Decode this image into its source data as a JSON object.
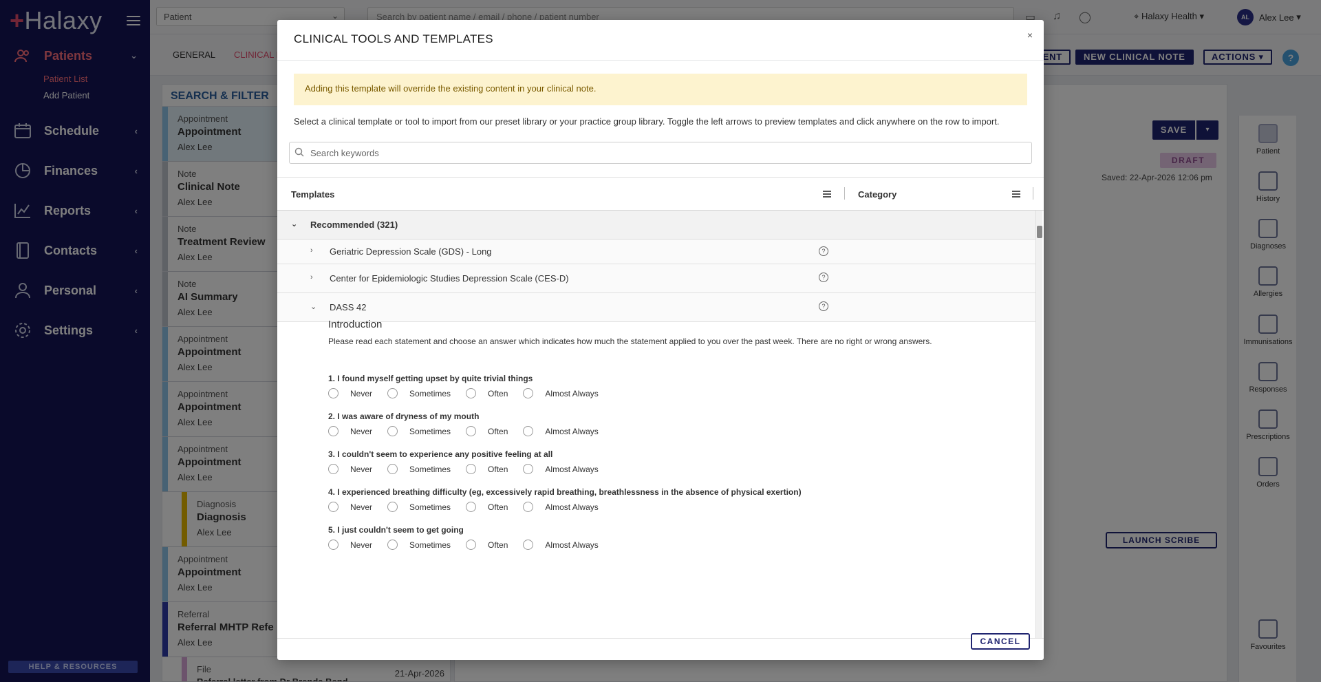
{
  "app": {
    "logo_text": "Halaxy",
    "help_resources": "HELP & RESOURCES"
  },
  "sidebar": {
    "items": [
      {
        "label": "Patients",
        "icon": "people-icon"
      },
      {
        "label": "Schedule",
        "icon": "calendar-icon"
      },
      {
        "label": "Finances",
        "icon": "pie-chart-icon"
      },
      {
        "label": "Reports",
        "icon": "line-chart-icon"
      },
      {
        "label": "Contacts",
        "icon": "contact-book-icon"
      },
      {
        "label": "Personal",
        "icon": "person-icon"
      },
      {
        "label": "Settings",
        "icon": "gear-icon"
      }
    ],
    "sub_items": [
      "Patient List",
      "Add Patient"
    ]
  },
  "topbar": {
    "patient_select": "Patient",
    "search_placeholder": "Search by patient name / email / phone / patient number",
    "organization": "Halaxy Health",
    "user_initials": "AL",
    "user_name": "Alex Lee"
  },
  "tabs": {
    "general": "GENERAL",
    "clinical": "CLINICAL N"
  },
  "header_buttons": {
    "ent": "ENT",
    "new_clinical_note": "NEW CLINICAL NOTE",
    "actions": "ACTIONS",
    "help": "?"
  },
  "filter": {
    "title": "SEARCH & FILTER",
    "cards": [
      {
        "type": "Appointment",
        "title": "Appointment",
        "who": "Alex Lee",
        "color": "#8ec5e8"
      },
      {
        "type": "Note",
        "title": "Clinical Note",
        "who": "Alex Lee",
        "color": "#bfc4cc"
      },
      {
        "type": "Note",
        "title": "Treatment Review",
        "who": "Alex Lee",
        "color": "#bfc4cc"
      },
      {
        "type": "Note",
        "title": "AI Summary",
        "who": "Alex Lee",
        "color": "#bfc4cc"
      },
      {
        "type": "Appointment",
        "title": "Appointment",
        "who": "Alex Lee",
        "color": "#8ec5e8"
      },
      {
        "type": "Appointment",
        "title": "Appointment",
        "who": "Alex Lee",
        "color": "#8ec5e8"
      },
      {
        "type": "Appointment",
        "title": "Appointment",
        "who": "Alex Lee",
        "color": "#8ec5e8"
      },
      {
        "type": "Diagnosis",
        "title": "Diagnosis",
        "who": "Alex Lee",
        "color": "#e6b800"
      },
      {
        "type": "Appointment",
        "title": "Appointment",
        "who": "Alex Lee",
        "color": "#8ec5e8"
      },
      {
        "type": "Referral",
        "title": "Referral MHTP Refe",
        "who": "Alex Lee",
        "color": "#2e3aa8"
      },
      {
        "type": "File",
        "title": "Referral letter from Dr Brenda Bend",
        "who": "21-Apr-2026",
        "color": "#d9a6d9"
      }
    ]
  },
  "editor": {
    "save": "SAVE",
    "status": "DRAFT",
    "saved_at": "Saved: 22-Apr-2026 12:06 pm",
    "launch_scribe": "LAUNCH SCRIBE"
  },
  "rail": {
    "items": [
      "Patient",
      "History",
      "Diagnoses",
      "Allergies",
      "Immunisations",
      "Responses",
      "Prescriptions",
      "Orders",
      "Favourites"
    ]
  },
  "modal": {
    "title": "CLINICAL TOOLS AND TEMPLATES",
    "warning": "Adding this template will override the existing content in your clinical note.",
    "instructions": "Select a clinical template or tool to import from our preset library or your practice group library. Toggle the left arrows to preview templates and click anywhere on the row to import.",
    "search_placeholder": "Search keywords",
    "columns": {
      "templates": "Templates",
      "category": "Category"
    },
    "group": "Recommended (321)",
    "rows": [
      "Geriatric Depression Scale (GDS) - Long",
      "Center for Epidemiologic Studies Depression Scale (CES-D)",
      "DASS 42"
    ],
    "preview": {
      "heading": "Introduction",
      "intro": "Please read each statement and choose an answer which indicates how much the statement applied to you over the past week. There are no right or wrong answers.",
      "options": [
        "Never",
        "Sometimes",
        "Often",
        "Almost Always"
      ],
      "questions": [
        "1. I found myself getting upset by quite trivial things",
        "2. I was aware of dryness of my mouth",
        "3. I couldn't seem to experience any positive feeling at all",
        "4. I experienced breathing difficulty (eg, excessively rapid breathing, breathlessness in the absence of physical exertion)",
        "5. I just couldn't seem to get going"
      ]
    },
    "cancel": "CANCEL",
    "close": "×"
  }
}
